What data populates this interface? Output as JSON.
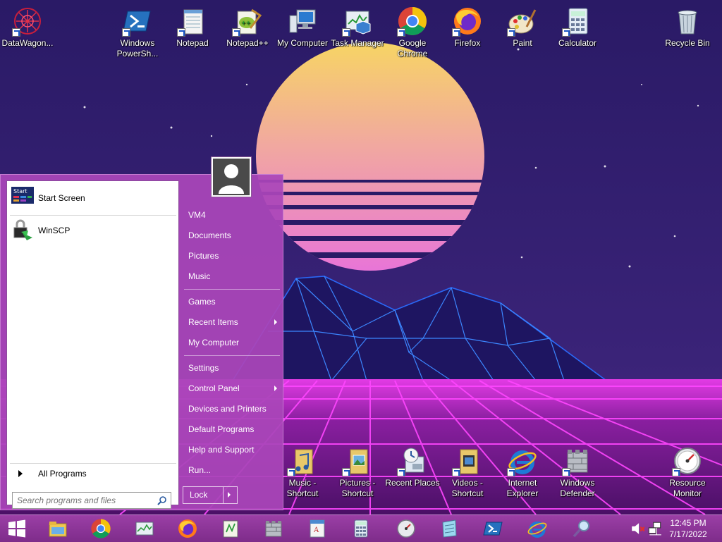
{
  "desktop": {
    "icons": [
      {
        "label": "DataWagon...",
        "icon": "datawagon-icon"
      },
      {
        "label": "Windows PowerSh...",
        "icon": "powershell-icon"
      },
      {
        "label": "Notepad",
        "icon": "notepad-icon"
      },
      {
        "label": "Notepad++",
        "icon": "notepadpp-icon"
      },
      {
        "label": "My Computer",
        "icon": "computer-icon"
      },
      {
        "label": "Task Manager",
        "icon": "task-manager-icon"
      },
      {
        "label": "Google Chrome",
        "icon": "chrome-icon"
      },
      {
        "label": "Firefox",
        "icon": "firefox-icon"
      },
      {
        "label": "Paint",
        "icon": "paint-icon"
      },
      {
        "label": "Calculator",
        "icon": "calculator-icon"
      },
      {
        "label": "Recycle Bin",
        "icon": "recycle-bin-icon"
      },
      {
        "label": "Music - Shortcut",
        "icon": "music-folder-icon"
      },
      {
        "label": "Pictures - Shortcut",
        "icon": "pictures-folder-icon"
      },
      {
        "label": "Recent Places",
        "icon": "recent-places-icon"
      },
      {
        "label": "Videos - Shortcut",
        "icon": "videos-folder-icon"
      },
      {
        "label": "Internet Explorer",
        "icon": "internet-explorer-icon"
      },
      {
        "label": "Windows Defender",
        "icon": "windows-defender-icon"
      },
      {
        "label": "Resource Monitor",
        "icon": "resource-monitor-icon"
      }
    ]
  },
  "start_menu": {
    "pinned": [
      {
        "label": "Start Screen",
        "icon": "start-screen-icon",
        "tile_text": "Start"
      },
      {
        "label": "WinSCP",
        "icon": "winscp-icon"
      }
    ],
    "all_programs_label": "All Programs",
    "search_placeholder": "Search programs and files",
    "right_items": [
      {
        "label": "VM4",
        "submenu": false
      },
      {
        "label": "Documents",
        "submenu": false
      },
      {
        "label": "Pictures",
        "submenu": false
      },
      {
        "label": "Music",
        "submenu": false
      },
      {
        "label": "Games",
        "submenu": false
      },
      {
        "label": "Recent Items",
        "submenu": true
      },
      {
        "label": "My Computer",
        "submenu": false
      },
      {
        "label": "Settings",
        "submenu": false
      },
      {
        "label": "Control Panel",
        "submenu": true
      },
      {
        "label": "Devices and Printers",
        "submenu": false
      },
      {
        "label": "Default Programs",
        "submenu": false
      },
      {
        "label": "Help and Support",
        "submenu": false
      },
      {
        "label": "Run...",
        "submenu": false
      }
    ],
    "lock_label": "Lock"
  },
  "taskbar": {
    "items": [
      "start-button",
      "file-explorer-icon",
      "chrome-icon",
      "task-manager-icon",
      "firefox-icon",
      "notepadpp-icon",
      "windows-defender-icon",
      "wordpad-icon",
      "calculator-icon",
      "resource-monitor-icon",
      "notepad-icon",
      "powershell-icon",
      "internet-explorer-icon",
      "magnifier-icon"
    ],
    "time": "12:45 PM",
    "date": "7/17/2022"
  },
  "colors": {
    "start_menu_bg": "#aa46b9",
    "taskbar_bg": "#8b3497",
    "sun_top": "#f7d563",
    "sun_bottom": "#e87fd8",
    "grid": "#ff33ff"
  }
}
